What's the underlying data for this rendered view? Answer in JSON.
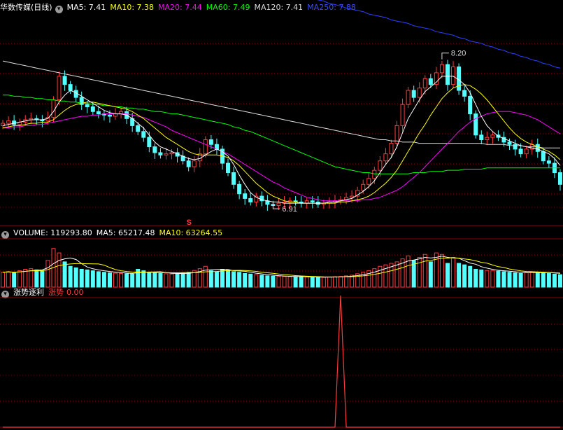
{
  "colors": {
    "up": "#ff3b3b",
    "down": "#54ffff",
    "ma5": "#ffffff",
    "ma10": "#ffff00",
    "ma20": "#ff00ff",
    "ma60": "#00ff00",
    "ma120": "#dddddd",
    "ma250": "#3040ff",
    "grid": "#8b0000"
  },
  "price_header": {
    "name": "华数传媒(日线)",
    "ma5": "MA5: 7.41",
    "ma10": "MA10: 7.38",
    "ma20": "MA20: 7.44",
    "ma60": "MA60: 7.49",
    "ma120": "MA120: 7.41",
    "ma250": "MA250: 7.88"
  },
  "volume_header": {
    "title": "VOLUME: 119293.80",
    "ma5": "MA5: 65217.48",
    "ma10": "MA10: 63264.55"
  },
  "ind_header": {
    "name": "涨势逐利",
    "label": "涨势",
    "value": "0.00"
  },
  "annotations": {
    "high": "8.20",
    "low": "6.91",
    "signal": "S"
  },
  "chart_data": [
    {
      "type": "candlestick",
      "title": "华数传媒(日线)",
      "ylim": [
        6.75,
        8.55
      ],
      "count": 100,
      "close": [
        7.62,
        7.64,
        7.61,
        7.63,
        7.65,
        7.66,
        7.65,
        7.64,
        7.67,
        7.82,
        8.02,
        7.95,
        7.9,
        7.84,
        7.78,
        7.76,
        7.72,
        7.7,
        7.69,
        7.68,
        7.7,
        7.72,
        7.66,
        7.6,
        7.55,
        7.5,
        7.42,
        7.37,
        7.35,
        7.36,
        7.37,
        7.34,
        7.3,
        7.25,
        7.3,
        7.36,
        7.48,
        7.44,
        7.4,
        7.28,
        7.2,
        7.1,
        7.02,
        6.98,
        6.95,
        7.0,
        6.96,
        6.93,
        6.92,
        6.94,
        6.95,
        6.96,
        6.95,
        6.94,
        6.96,
        6.95,
        6.93,
        6.94,
        6.95,
        6.96,
        6.97,
        6.99,
        7.0,
        7.05,
        7.1,
        7.15,
        7.22,
        7.3,
        7.36,
        7.45,
        7.6,
        7.78,
        7.9,
        7.84,
        7.92,
        8.0,
        7.95,
        8.05,
        8.12,
        7.95,
        8.1,
        7.9,
        7.85,
        7.7,
        7.52,
        7.48,
        7.5,
        7.52,
        7.5,
        7.46,
        7.44,
        7.4,
        7.36,
        7.4,
        7.44,
        7.38,
        7.3,
        7.28,
        7.2,
        7.1
      ],
      "ma5": [
        7.6,
        7.61,
        7.62,
        7.63,
        7.64,
        7.65,
        7.65,
        7.65,
        7.66,
        7.72,
        7.8,
        7.86,
        7.9,
        7.88,
        7.85,
        7.82,
        7.79,
        7.76,
        7.73,
        7.71,
        7.7,
        7.7,
        7.69,
        7.66,
        7.62,
        7.58,
        7.52,
        7.46,
        7.42,
        7.4,
        7.38,
        7.36,
        7.34,
        7.32,
        7.31,
        7.32,
        7.35,
        7.38,
        7.4,
        7.38,
        7.34,
        7.27,
        7.18,
        7.1,
        7.03,
        6.99,
        6.97,
        6.96,
        6.95,
        6.95,
        6.94,
        6.94,
        6.94,
        6.94,
        6.94,
        6.94,
        6.94,
        6.94,
        6.95,
        6.95,
        6.96,
        6.97,
        6.98,
        7.01,
        7.04,
        7.08,
        7.13,
        7.2,
        7.27,
        7.33,
        7.42,
        7.54,
        7.66,
        7.74,
        7.82,
        7.89,
        7.93,
        7.97,
        8.02,
        8.02,
        8.02,
        7.99,
        7.95,
        7.88,
        7.78,
        7.68,
        7.6,
        7.55,
        7.51,
        7.49,
        7.47,
        7.45,
        7.43,
        7.42,
        7.41,
        7.4,
        7.38,
        7.36,
        7.32,
        7.26
      ],
      "ma10": [
        7.58,
        7.59,
        7.6,
        7.6,
        7.61,
        7.62,
        7.62,
        7.63,
        7.63,
        7.65,
        7.69,
        7.73,
        7.76,
        7.78,
        7.79,
        7.8,
        7.8,
        7.79,
        7.78,
        7.77,
        7.76,
        7.75,
        7.74,
        7.72,
        7.69,
        7.66,
        7.62,
        7.58,
        7.54,
        7.5,
        7.47,
        7.44,
        7.41,
        7.38,
        7.36,
        7.35,
        7.35,
        7.35,
        7.35,
        7.34,
        7.33,
        7.3,
        7.26,
        7.21,
        7.16,
        7.11,
        7.07,
        7.03,
        7.0,
        6.98,
        6.96,
        6.95,
        6.95,
        6.94,
        6.94,
        6.94,
        6.94,
        6.94,
        6.94,
        6.94,
        6.95,
        6.95,
        6.96,
        6.97,
        6.98,
        7.0,
        7.03,
        7.07,
        7.11,
        7.16,
        7.22,
        7.3,
        7.38,
        7.46,
        7.54,
        7.61,
        7.69,
        7.76,
        7.83,
        7.88,
        7.92,
        7.94,
        7.95,
        7.94,
        7.91,
        7.87,
        7.82,
        7.76,
        7.7,
        7.64,
        7.58,
        7.53,
        7.49,
        7.46,
        7.44,
        7.42,
        7.4,
        7.38,
        7.35,
        7.31
      ],
      "ma20": [
        7.58,
        7.58,
        7.59,
        7.59,
        7.6,
        7.6,
        7.61,
        7.61,
        7.62,
        7.63,
        7.64,
        7.65,
        7.66,
        7.67,
        7.68,
        7.68,
        7.69,
        7.69,
        7.7,
        7.7,
        7.7,
        7.7,
        7.7,
        7.69,
        7.68,
        7.67,
        7.65,
        7.63,
        7.61,
        7.59,
        7.56,
        7.54,
        7.52,
        7.5,
        7.48,
        7.46,
        7.44,
        7.42,
        7.4,
        7.38,
        7.36,
        7.33,
        7.3,
        7.27,
        7.24,
        7.21,
        7.18,
        7.15,
        7.12,
        7.1,
        7.07,
        7.05,
        7.03,
        7.01,
        6.99,
        6.98,
        6.97,
        6.96,
        6.96,
        6.96,
        6.96,
        6.96,
        6.96,
        6.96,
        6.97,
        6.97,
        6.98,
        6.99,
        7.01,
        7.03,
        7.05,
        7.08,
        7.12,
        7.16,
        7.2,
        7.25,
        7.3,
        7.35,
        7.4,
        7.45,
        7.5,
        7.55,
        7.59,
        7.63,
        7.66,
        7.68,
        7.7,
        7.71,
        7.72,
        7.72,
        7.72,
        7.71,
        7.7,
        7.69,
        7.67,
        7.65,
        7.62,
        7.59,
        7.56,
        7.53
      ],
      "ma60": [
        7.86,
        7.86,
        7.85,
        7.85,
        7.84,
        7.84,
        7.83,
        7.83,
        7.82,
        7.82,
        7.81,
        7.81,
        7.8,
        7.8,
        7.79,
        7.79,
        7.78,
        7.78,
        7.77,
        7.77,
        7.76,
        7.76,
        7.75,
        7.75,
        7.74,
        7.74,
        7.73,
        7.72,
        7.72,
        7.71,
        7.7,
        7.7,
        7.69,
        7.68,
        7.67,
        7.66,
        7.65,
        7.64,
        7.63,
        7.62,
        7.61,
        7.59,
        7.58,
        7.56,
        7.55,
        7.53,
        7.51,
        7.49,
        7.47,
        7.45,
        7.43,
        7.41,
        7.39,
        7.37,
        7.35,
        7.33,
        7.31,
        7.29,
        7.27,
        7.25,
        7.24,
        7.23,
        7.22,
        7.21,
        7.2,
        7.2,
        7.19,
        7.19,
        7.19,
        7.19,
        7.19,
        7.19,
        7.19,
        7.2,
        7.2,
        7.2,
        7.21,
        7.21,
        7.21,
        7.22,
        7.22,
        7.22,
        7.23,
        7.23,
        7.23,
        7.23,
        7.24,
        7.24,
        7.24,
        7.24,
        7.24,
        7.24,
        7.24,
        7.24,
        7.24,
        7.24,
        7.24,
        7.24,
        7.24,
        7.24
      ],
      "ma120": [
        8.15,
        8.14,
        8.13,
        8.12,
        8.11,
        8.1,
        8.09,
        8.08,
        8.07,
        8.06,
        8.05,
        8.04,
        8.03,
        8.02,
        8.01,
        8.0,
        7.99,
        7.98,
        7.97,
        7.96,
        7.95,
        7.94,
        7.93,
        7.92,
        7.91,
        7.9,
        7.89,
        7.88,
        7.87,
        7.86,
        7.85,
        7.84,
        7.83,
        7.82,
        7.81,
        7.8,
        7.79,
        7.78,
        7.77,
        7.76,
        7.75,
        7.74,
        7.73,
        7.72,
        7.71,
        7.7,
        7.69,
        7.68,
        7.67,
        7.66,
        7.65,
        7.64,
        7.63,
        7.62,
        7.61,
        7.6,
        7.59,
        7.58,
        7.57,
        7.56,
        7.55,
        7.54,
        7.53,
        7.52,
        7.51,
        7.5,
        7.49,
        7.48,
        7.48,
        7.47,
        7.47,
        7.46,
        7.46,
        7.46,
        7.45,
        7.45,
        7.45,
        7.45,
        7.45,
        7.45,
        7.45,
        7.45,
        7.45,
        7.45,
        7.45,
        7.45,
        7.44,
        7.44,
        7.44,
        7.44,
        7.43,
        7.43,
        7.43,
        7.42,
        7.42,
        7.42,
        7.41,
        7.41,
        7.41,
        7.41
      ],
      "ma250": [
        9.5,
        9.48,
        9.47,
        9.45,
        9.44,
        9.42,
        9.41,
        9.39,
        9.38,
        9.36,
        9.35,
        9.33,
        9.32,
        9.3,
        9.29,
        9.27,
        9.26,
        9.24,
        9.23,
        9.21,
        9.2,
        9.18,
        9.17,
        9.15,
        9.14,
        9.12,
        9.11,
        9.09,
        9.08,
        9.06,
        9.05,
        9.03,
        9.02,
        9.0,
        8.99,
        8.97,
        8.96,
        8.94,
        8.93,
        8.91,
        8.9,
        8.88,
        8.87,
        8.85,
        8.84,
        8.82,
        8.81,
        8.79,
        8.78,
        8.76,
        8.75,
        8.74,
        8.72,
        8.71,
        8.7,
        8.68,
        8.67,
        8.66,
        8.64,
        8.63,
        8.62,
        8.6,
        8.59,
        8.58,
        8.57,
        8.55,
        8.54,
        8.53,
        8.52,
        8.5,
        8.49,
        8.48,
        8.47,
        8.45,
        8.44,
        8.43,
        8.42,
        8.4,
        8.39,
        8.38,
        8.37,
        8.35,
        8.34,
        8.32,
        8.31,
        8.3,
        8.28,
        8.27,
        8.25,
        8.24,
        8.22,
        8.21,
        8.19,
        8.18,
        8.16,
        8.15,
        8.13,
        8.12,
        8.1,
        8.09
      ],
      "high_label": 8.2,
      "low_label": 6.91
    },
    {
      "type": "bar",
      "title": "VOLUME",
      "ylim": [
        0,
        160000
      ],
      "values": [
        50000,
        52000,
        48000,
        55000,
        60000,
        62000,
        58000,
        55000,
        90000,
        130000,
        115000,
        85000,
        70000,
        65000,
        60000,
        58000,
        55000,
        52000,
        50000,
        48000,
        47000,
        46000,
        45000,
        44000,
        60000,
        55000,
        50000,
        48000,
        46000,
        45000,
        44000,
        46000,
        48000,
        50000,
        56000,
        62000,
        70000,
        55000,
        52000,
        60000,
        58000,
        52000,
        50000,
        46000,
        44000,
        42000,
        40000,
        38000,
        37000,
        36000,
        36000,
        35000,
        35000,
        34000,
        34000,
        34000,
        33000,
        33000,
        34000,
        35000,
        36000,
        38000,
        40000,
        45000,
        50000,
        55000,
        62000,
        70000,
        75000,
        80000,
        85000,
        95000,
        105000,
        90000,
        100000,
        110000,
        85000,
        115000,
        110000,
        80000,
        100000,
        80000,
        75000,
        70000,
        60000,
        58000,
        56000,
        55000,
        54000,
        52000,
        50000,
        48000,
        46000,
        48000,
        52000,
        50000,
        48000,
        46000,
        44000,
        42000
      ]
    },
    {
      "type": "line",
      "title": "涨势逐利",
      "ylim": [
        0,
        1
      ],
      "values": [
        0,
        0,
        0,
        0,
        0,
        0,
        0,
        0,
        0,
        0,
        0,
        0,
        0,
        0,
        0,
        0,
        0,
        0,
        0,
        0,
        0,
        0,
        0,
        0,
        0,
        0,
        0,
        0,
        0,
        0,
        0,
        0,
        0,
        0,
        0,
        0,
        0,
        0,
        0,
        0,
        0,
        0,
        0,
        0,
        0,
        0,
        0,
        0,
        0,
        0,
        0,
        0,
        0,
        0,
        0,
        0,
        0,
        0,
        0,
        0,
        0,
        0,
        0,
        0,
        0,
        0,
        0,
        0,
        0,
        0,
        0,
        0,
        0,
        0,
        0,
        0,
        0,
        0,
        0,
        0,
        0,
        0,
        0,
        0,
        0,
        0,
        0,
        0,
        0,
        0,
        0,
        0,
        0,
        0,
        0,
        0,
        0,
        0,
        0,
        0
      ],
      "spike_index": 60,
      "spike_value": 1
    }
  ]
}
